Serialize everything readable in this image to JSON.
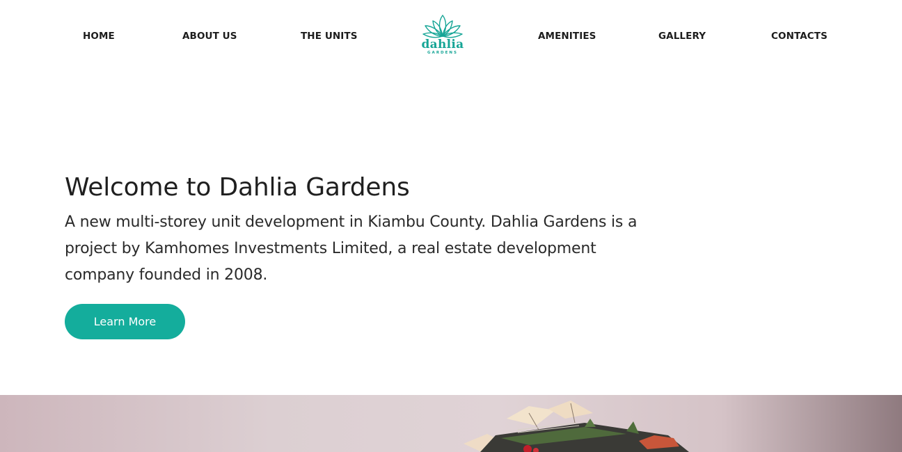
{
  "nav": {
    "home": "HOME",
    "about": "ABOUT US",
    "units": "THE UNITS",
    "amenities": "AMENITIES",
    "gallery": "GALLERY",
    "contacts": "CONTACTS"
  },
  "logo": {
    "name": "dahlia",
    "sub": "GARDENS",
    "icon": "lotus-icon"
  },
  "hero": {
    "title": "Welcome to Dahlia Gardens",
    "text": "A new multi-storey unit development in Kiambu County. Dahlia Gardens is a project by Kamhomes Investments Limited, a real estate development company founded in 2008.",
    "button": "Learn More"
  },
  "colors": {
    "accent": "#14ad9c",
    "text": "#1f1f1f"
  }
}
